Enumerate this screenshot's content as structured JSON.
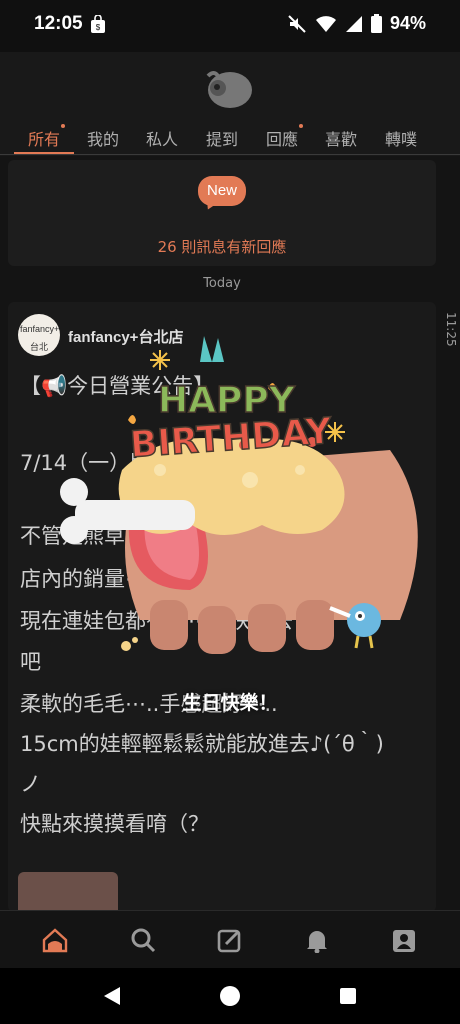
{
  "status_bar": {
    "time": "12:05",
    "battery": "94%",
    "icons": [
      "bag-icon",
      "mute-icon",
      "wifi-icon",
      "signal-icon",
      "battery-icon"
    ]
  },
  "header": {
    "tabs": [
      {
        "label": "所有",
        "active": true,
        "dot": true
      },
      {
        "label": "我的",
        "active": false,
        "dot": false
      },
      {
        "label": "私人",
        "active": false,
        "dot": false
      },
      {
        "label": "提到",
        "active": false,
        "dot": false
      },
      {
        "label": "回應",
        "active": false,
        "dot": true
      },
      {
        "label": "喜歡",
        "active": false,
        "dot": false
      },
      {
        "label": "轉噗",
        "active": false,
        "dot": false
      }
    ]
  },
  "notice": {
    "badge": "New",
    "text": "26 則訊息有新回應"
  },
  "feed": {
    "date_label": "Today",
    "side_time": "11:25"
  },
  "post": {
    "author": "fanfancy+台北店",
    "avatar_text_1": "fanfancy+",
    "avatar_text_2": "台北",
    "lines": [
      "【📢今日營業公告】",
      "7/14（一）照常營業",
      "不管是熊草還是⋯⋯⋯⋯一直是",
      "店內的銷量⋯⋯",
      "現在連娃包都有了⋯⋯快來去",
      "吧",
      "柔軟的毛毛⋯..手感超好⋯..",
      "15cm的娃輕輕鬆鬆就能放進去♪(´θ｀)",
      "ノ",
      "快點來摸摸看唷（？"
    ]
  },
  "overlay": {
    "caption": "生日快樂！",
    "banner_top": "HAPPY",
    "banner_bottom": "BIRTHDAY"
  },
  "bottom_nav": [
    "home-icon",
    "search-icon",
    "compose-icon",
    "bell-icon",
    "profile-icon"
  ],
  "colors": {
    "accent": "#e27a55",
    "background": "#141414",
    "card": "#1a1a1a"
  }
}
